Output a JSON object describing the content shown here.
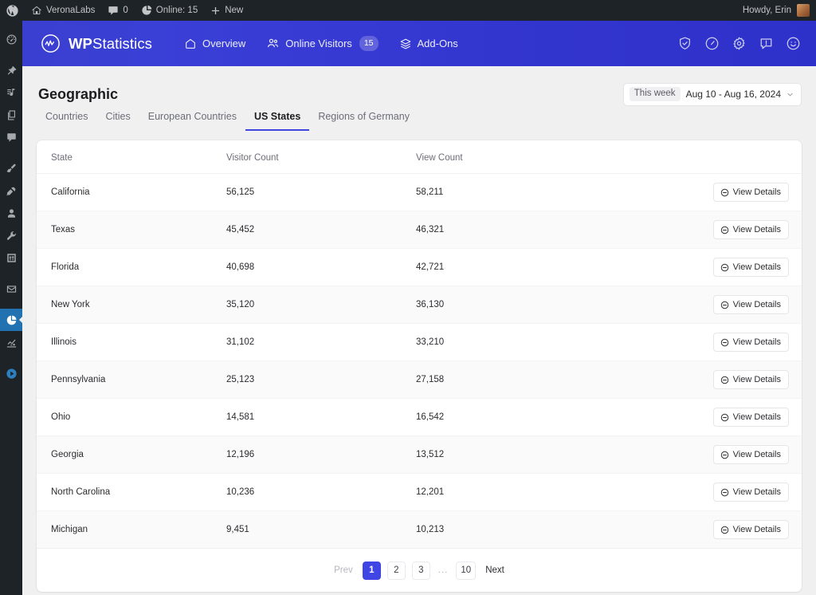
{
  "adminbar": {
    "wp_logo": "wordpress-logo-icon",
    "site_name": "VeronaLabs",
    "comments_count": "0",
    "online_label": "Online: 15",
    "new_label": "New",
    "howdy": "Howdy, Erin"
  },
  "adminmenu": {
    "items": [
      {
        "name": "dashboard",
        "icon": "dashboard-icon",
        "current": false
      },
      {
        "name": "posts",
        "icon": "pin-icon",
        "current": false
      },
      {
        "name": "media",
        "icon": "media-icon",
        "current": false
      },
      {
        "name": "pages",
        "icon": "pages-icon",
        "current": false
      },
      {
        "name": "comments",
        "icon": "comment-icon",
        "current": false
      },
      {
        "name": "appearance",
        "icon": "paintbrush-icon",
        "current": false
      },
      {
        "name": "plugins",
        "icon": "plug-icon",
        "current": false
      },
      {
        "name": "users",
        "icon": "user-icon",
        "current": false
      },
      {
        "name": "tools",
        "icon": "wrench-icon",
        "current": false
      },
      {
        "name": "settings",
        "icon": "sliders-icon",
        "current": false
      },
      {
        "name": "mail",
        "icon": "envelope-icon",
        "current": false
      },
      {
        "name": "statistics",
        "icon": "pie-chart-icon",
        "current": true
      },
      {
        "name": "analytics",
        "icon": "bar-chart-icon",
        "current": false
      },
      {
        "name": "media-player",
        "icon": "play-circle-icon",
        "current": false
      }
    ]
  },
  "header": {
    "brand_bold": "WP",
    "brand_light": "Statistics",
    "brand_icon": "wpstatistics-logo-icon",
    "nav": [
      {
        "label": "Overview",
        "icon": "home-icon",
        "badge": null
      },
      {
        "label": "Online Visitors",
        "icon": "users-icon",
        "badge": "15"
      },
      {
        "label": "Add-Ons",
        "icon": "layers-icon",
        "badge": null
      }
    ],
    "icons": [
      {
        "name": "shield-check-icon"
      },
      {
        "name": "gauge-icon"
      },
      {
        "name": "gear-icon"
      },
      {
        "name": "help-chat-icon"
      },
      {
        "name": "smiley-icon"
      }
    ]
  },
  "page": {
    "title": "Geographic",
    "daterange": {
      "preset": "This week",
      "range": "Aug 10 - Aug 16, 2024",
      "caret": "chevron-down-icon"
    },
    "tabs": [
      {
        "label": "Countries",
        "active": false
      },
      {
        "label": "Cities",
        "active": false
      },
      {
        "label": "European Countries",
        "active": false
      },
      {
        "label": "US States",
        "active": true
      },
      {
        "label": "Regions of Germany",
        "active": false
      }
    ]
  },
  "table": {
    "columns": [
      "State",
      "Visitor Count",
      "View Count"
    ],
    "action_label": "View Details",
    "action_icon": "minus-circle-icon",
    "rows": [
      {
        "state": "California",
        "visitors": "56,125",
        "views": "58,211"
      },
      {
        "state": "Texas",
        "visitors": "45,452",
        "views": "46,321"
      },
      {
        "state": "Florida",
        "visitors": "40,698",
        "views": "42,721"
      },
      {
        "state": "New York",
        "visitors": "35,120",
        "views": "36,130"
      },
      {
        "state": "Illinois",
        "visitors": "31,102",
        "views": "33,210"
      },
      {
        "state": "Pennsylvania",
        "visitors": "25,123",
        "views": "27,158"
      },
      {
        "state": "Ohio",
        "visitors": "14,581",
        "views": "16,542"
      },
      {
        "state": "Georgia",
        "visitors": "12,196",
        "views": "13,512"
      },
      {
        "state": "North Carolina",
        "visitors": "10,236",
        "views": "12,201"
      },
      {
        "state": "Michigan",
        "visitors": "9,451",
        "views": "10,213"
      }
    ]
  },
  "pagination": {
    "prev": "Prev",
    "next": "Next",
    "ellipsis": "...",
    "pages": [
      "1",
      "2",
      "3"
    ],
    "last": "10",
    "current": "1"
  },
  "colors": {
    "brand_blue": "#3f46e0",
    "header_gradient_from": "#3b3fd0",
    "header_gradient_to": "#2e31c9",
    "admin_dark": "#1d2327",
    "admin_current": "#2271b1",
    "page_bg": "#f0f0f1"
  }
}
